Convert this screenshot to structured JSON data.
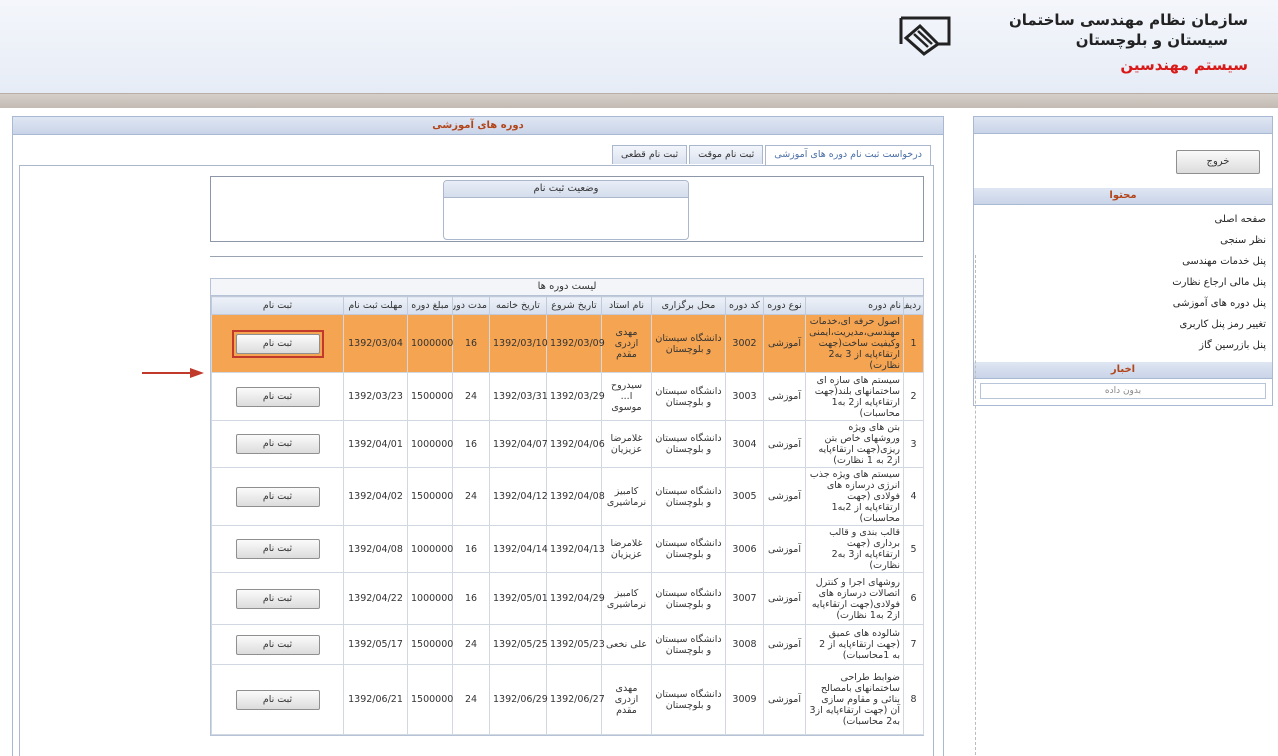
{
  "header": {
    "org_line1": "سازمان نظام مهندسی ساختمان",
    "org_line2": "سیستان و بلوچستان",
    "brand": "سیستم مهندسین"
  },
  "sidebar": {
    "exit_label": "خروج",
    "content_title": "محتوا",
    "menu": [
      "صفحه اصلی",
      "نظر سنجی",
      "پنل خدمات مهندسی",
      "پنل مالی ارجاع نظارت",
      "پنل دوره های آموزشی",
      "تغییر رمز پنل کاربری",
      "پنل بازرسین گاز"
    ],
    "news_title": "اخبار",
    "news_empty": "بدون داده"
  },
  "main": {
    "title": "دوره های آموزشی",
    "tabs": [
      "درخواست ثبت نام دوره های آموزشی",
      "ثبت نام موقت",
      "ثبت نام قطعی"
    ],
    "status_title": "وضعیت ثبت نام",
    "list_title": "لیست دوره ها",
    "columns": [
      "ردیف",
      "نام دوره",
      "نوع دوره",
      "کد دوره",
      "محل برگزاری",
      "نام استاد",
      "تاریخ شروع",
      "تاریخ خاتمه",
      "مدت دوره",
      "مبلغ دوره",
      "مهلت ثبت نام",
      "ثبت نام"
    ],
    "register_label": "ثبت نام",
    "rows": [
      {
        "no": "1",
        "name": "اصول حرفه ای،خدمات مهندسی،مدیریت،ایمنی وکیفیت ساخت(جهت ارتقاءپایه از 3 به2 نظارت)",
        "type": "آموزشی",
        "code": "3002",
        "place": "دانشگاه سیستان و بلوچستان",
        "teacher": "مهدی ازدری مقدم",
        "start": "1392/03/09",
        "end": "1392/03/10",
        "duration": "16",
        "price": "1000000",
        "deadline": "1392/03/04",
        "highlight": true
      },
      {
        "no": "2",
        "name": "سیستم های سازه ای ساختمانهای بلند(جهت ارتقاءپایه از2 به1 محاسبات)",
        "type": "آموزشی",
        "code": "3003",
        "place": "دانشگاه سیستان و بلوچستان",
        "teacher": "سیدروح ا... موسوی",
        "start": "1392/03/29",
        "end": "1392/03/31",
        "duration": "24",
        "price": "1500000",
        "deadline": "1392/03/23",
        "highlight": false
      },
      {
        "no": "3",
        "name": "بتن های ویژه وروشهای خاص بتن ریزی(جهت ارتقاءپایه از2 به 1 نظارت)",
        "type": "آموزشی",
        "code": "3004",
        "place": "دانشگاه سیستان و بلوچستان",
        "teacher": "غلامرضا عزیزیان",
        "start": "1392/04/06",
        "end": "1392/04/07",
        "duration": "16",
        "price": "1000000",
        "deadline": "1392/04/01",
        "highlight": false
      },
      {
        "no": "4",
        "name": "سیستم های ویژه جذب انرژی درسازه های فولادی (جهت ارتقاءپایه از 2به1 محاسبات)",
        "type": "آموزشی",
        "code": "3005",
        "place": "دانشگاه سیستان و بلوچستان",
        "teacher": "کامبیز نرماشیری",
        "start": "1392/04/08",
        "end": "1392/04/12",
        "duration": "24",
        "price": "1500000",
        "deadline": "1392/04/02",
        "highlight": false
      },
      {
        "no": "5",
        "name": "قالب بندی و قالب برداری (جهت ارتقاءپایه از3 به2 نظارت)",
        "type": "آموزشی",
        "code": "3006",
        "place": "دانشگاه سیستان و بلوچستان",
        "teacher": "غلامرضا عزیزیان",
        "start": "1392/04/13",
        "end": "1392/04/14",
        "duration": "16",
        "price": "1000000",
        "deadline": "1392/04/08",
        "highlight": false
      },
      {
        "no": "6",
        "name": "روشهای اجرا و کنترل اتصالات درسازه های فولادی(جهت ارتقاءپایه از2 به1 نظارت)",
        "type": "آموزشی",
        "code": "3007",
        "place": "دانشگاه سیستان و بلوچستان",
        "teacher": "کامبیز نرماشیری",
        "start": "1392/04/29",
        "end": "1392/05/01",
        "duration": "16",
        "price": "1000000",
        "deadline": "1392/04/22",
        "highlight": false
      },
      {
        "no": "7",
        "name": "شالوده های عمیق (جهت ارتقاءپایه از 2 به 1محاسبات)",
        "type": "آموزشی",
        "code": "3008",
        "place": "دانشگاه سیستان و بلوچستان",
        "teacher": "علی نخعی",
        "start": "1392/05/23",
        "end": "1392/05/25",
        "duration": "24",
        "price": "1500000",
        "deadline": "1392/05/17",
        "highlight": false
      },
      {
        "no": "8",
        "name": "ضوابط طراحی ساختمانهای بامصالح بنائی و مقاوم سازی آن (جهت ارتقاءپایه از3 به2 محاسبات)",
        "type": "آموزشی",
        "code": "3009",
        "place": "دانشگاه سیستان و بلوچستان",
        "teacher": "مهدی ازدری مقدم",
        "start": "1392/06/27",
        "end": "1392/06/29",
        "duration": "24",
        "price": "1500000",
        "deadline": "1392/06/21",
        "highlight": false
      }
    ]
  },
  "colors": {
    "accent_orange": "#f5a552",
    "title_red": "#d91818",
    "highlight_border": "#c0392b"
  }
}
